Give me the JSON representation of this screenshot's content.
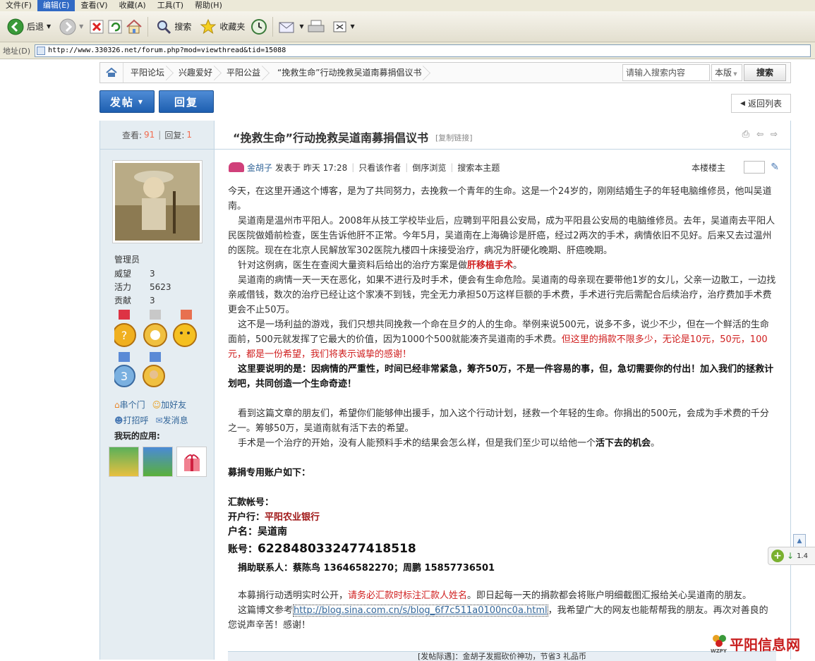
{
  "menu": [
    "文件(F)",
    "编辑(E)",
    "查看(V)",
    "收藏(A)",
    "工具(T)",
    "帮助(H)"
  ],
  "toolbar": {
    "back": "后退",
    "search": "搜索",
    "favorites": "收藏夹"
  },
  "address": {
    "label": "地址(D)",
    "url": "http://www.330326.net/forum.php?mod=viewthread&tid=15088"
  },
  "breadcrumb": [
    "平阳论坛",
    "兴趣爱好",
    "平阳公益",
    "“挽救生命”行动挽救吴道南募捐倡议书"
  ],
  "search": {
    "placeholder": "请输入搜索内容",
    "scope": "本版",
    "button": "搜索"
  },
  "buttons": {
    "post": "发帖",
    "reply": "回复",
    "back_list": "返回列表"
  },
  "stats": {
    "views_label": "查看:",
    "views": "91",
    "replies_label": "回复:",
    "replies": "1"
  },
  "thread": {
    "title": "“挽救生命”行动挽救吴道南募捐倡议书",
    "copy_link": "[复制链接]"
  },
  "author": {
    "name": "金胡子",
    "posted": "发表于 昨天 17:28",
    "only_author": "只看该作者",
    "reverse": "倒序浏览",
    "search_topic": "搜索本主题",
    "floor": "本楼楼主",
    "role": "管理员",
    "fields": [
      {
        "k": "威望",
        "v": "3"
      },
      {
        "k": "活力",
        "v": "5623"
      },
      {
        "k": "贡献",
        "v": "3"
      }
    ],
    "links": [
      "串个门",
      "加好友",
      "打招呼",
      "发消息"
    ],
    "apps_title": "我玩的应用:"
  },
  "content": {
    "p1": "今天，在这里开通这个博客，是为了共同努力，去挽救一个青年的生命。这是一个24岁的，刚刚结婚生子的年轻电脑维修员，他叫吴道南。",
    "p2": "吴道南是温州市平阳人。2008年从技工学校毕业后，应聘到平阳县公安局，成为平阳县公安局的电脑维修员。去年，吴道南去平阳人民医院做婚前检查，医生告诉他肝不正常。今年5月，吴道南在上海确诊是肝癌，经过2两次的手术，病情依旧不见好。后来又去过温州的医院。现在在北京人民解放军302医院九楼四十床接受治疗，病况为肝硬化晚期、肝癌晚期。",
    "p3a": "针对这例病，医生在查阅大量资料后给出的治疗方案是做",
    "p3b": "肝移植手术",
    "p3c": "。",
    "p4": "吴道南的病情一天一天在恶化，如果不进行及时手术，便会有生命危险。吴道南的母亲现在要带他1岁的女儿，父亲一边散工，一边找亲戚借钱，数次的治疗已经让这个家凑不到钱，完全无力承担50万这样巨额的手术费，手术进行完后需配合后续治疗，治疗费加手术费更会不止50万。",
    "p5a": "这不是一场利益的游戏，我们只想共同挽救一个命在旦夕的人的生命。举例来说500元，说多不多，说少不少，但在一个鲜活的生命面前，500元就发挥了它最大的价值，因为1000个500就能凑齐吴道南的手术费。",
    "p5b": "但这里的捐款不限多少，无论是10元，50元，100元，都是一份希望，我们将表示诚挚的感谢！",
    "p6": "这里要说明的是：因病情的严重性，时间已经非常紧急，筹齐50万，不是一件容易的事，但，急切需要你的付出！加入我们的拯救计划吧，共同创造一个生命奇迹！",
    "p7": "看到这篇文章的朋友们，希望你们能够伸出援手，加入这个行动计划，拯救一个年轻的生命。你捐出的500元，会成为手术费的千分之一。筹够50万，吴道南就有活下去的希望。",
    "p8a": "手术是一个治疗的开始，没有人能预料手术的结果会怎么样，但是我们至少可以给他一个",
    "p8b": "活下去的机会",
    "p8c": "。",
    "acct_title": "募捐专用账户如下：",
    "remit": "汇款帐号：",
    "bank_label": "开户行：",
    "bank": "平阳农业银行",
    "name_label": "户名：吴道南",
    "acct_label": "账号：",
    "acct": "6228480332477418518",
    "contact": "捐助联系人：蔡陈鸟 13646582270；周鹏 15857736501",
    "p9a": "本募捐行动透明实时公开，",
    "p9b": "请务必汇款时标注汇款人姓名",
    "p9c": "。即日起每一天的捐款都会将账户明细截图汇报给关心吴道南的朋友。",
    "p10a": "这篇博文参考",
    "p10link": "http://blog.sina.com.cn/s/blog_6f7c511a0100nc0a.html",
    "p10b": "，我希望广大的网友也能帮帮我的朋友。再次对善良的您说声辛苦！感谢！",
    "footer_bar": "[发帖际遇]：金胡子发掘砍价神功，节省3 礼品币"
  },
  "float_zoom": "1.4",
  "watermark": {
    "main": "平阳信息网",
    "sub": "WZPY"
  },
  "colors": {
    "accent_blue": "#1e5fb0",
    "link": "#336699",
    "red": "#d02020",
    "orange": "#f26c4f"
  }
}
